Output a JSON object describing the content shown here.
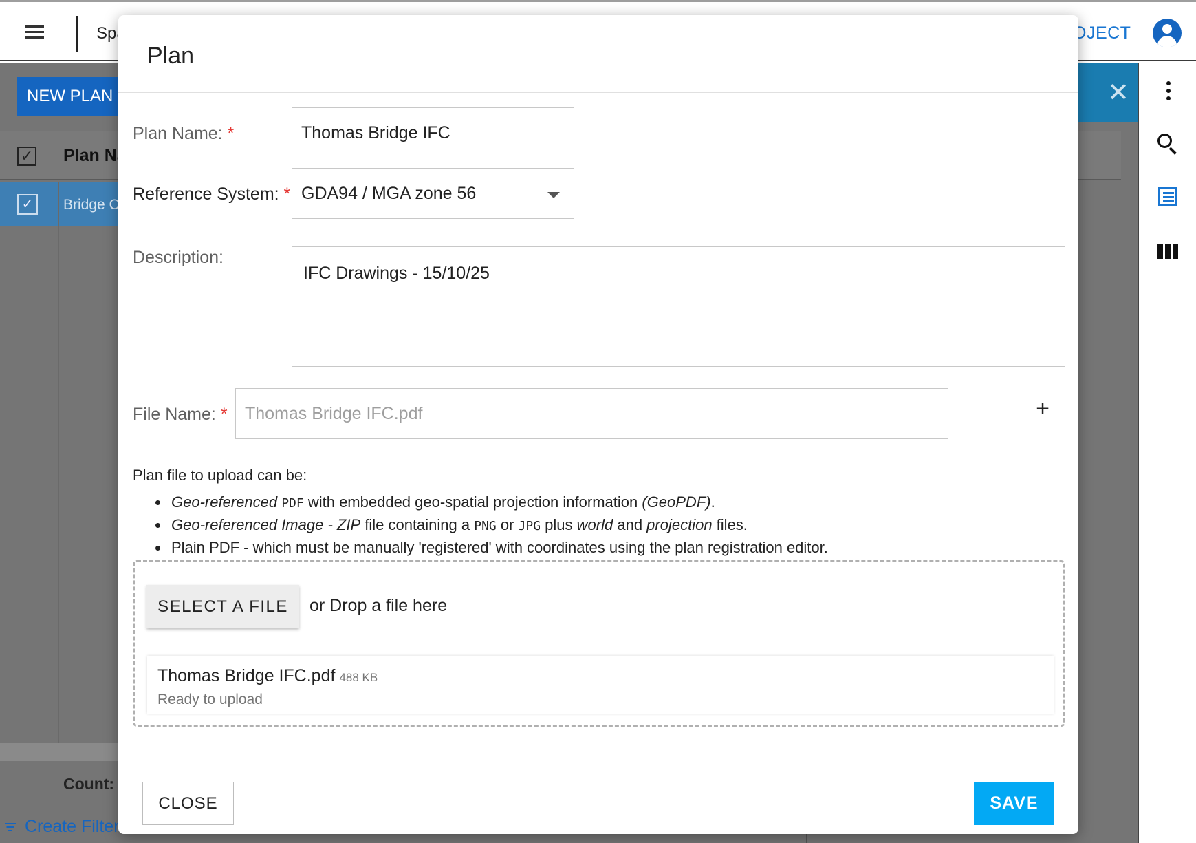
{
  "topbar": {
    "app_title": "Spa",
    "project_link": "OJECT"
  },
  "plans": {
    "new_plan_label": "NEW PLAN",
    "column_header": "Plan Na",
    "selected_row": "Bridge C",
    "count_label": "Count: ",
    "create_filter_label": "Create Filter"
  },
  "icons": {
    "menu": "hamburger-icon",
    "user": "account-circle-icon",
    "panel_close": "close-icon",
    "more": "kebab-icon",
    "search": "search-icon",
    "list": "list-icon",
    "columns": "columns-icon",
    "add": "plus-icon",
    "filter": "filter-icon"
  },
  "colors": {
    "primary": "#1565c0",
    "accent": "#03a9f4",
    "required": "#e53935"
  },
  "dialog": {
    "title": "Plan",
    "plan_name_label": "Plan Name:",
    "plan_name_value": "Thomas Bridge IFC",
    "reference_system_label": "Reference System:",
    "reference_system_value": "GDA94 / MGA zone 56",
    "description_label": "Description:",
    "description_value": "IFC Drawings - 15/10/25",
    "file_name_label": "File Name:",
    "file_name_placeholder": "Thomas Bridge IFC.pdf",
    "required_mark": "*",
    "add_button": "+",
    "info_intro": "Plan file to upload can be:",
    "info_items": {
      "geopdf": {
        "em1": "Geo-referenced ",
        "code": "PDF",
        "text": " with embedded geo-spatial projection information ",
        "em2": "(GeoPDF)",
        "end": "."
      },
      "image": {
        "em1": "Geo-referenced Image - ZIP",
        "text1": " file containing a ",
        "code1": "PNG",
        "text2": " or ",
        "code2": "JPG",
        "text3": " plus ",
        "em2": "world",
        "text4": " and ",
        "em3": "projection",
        "end": " files."
      },
      "plain": "Plain PDF - which must be manually 'registered' with coordinates using the plan registration editor."
    },
    "select_file_label": "SELECT A FILE",
    "drop_hint": "or Drop a file here",
    "file": {
      "name": "Thomas Bridge IFC.pdf",
      "size": "488 KB",
      "status": "Ready to upload"
    },
    "close_label": "CLOSE",
    "save_label": "SAVE"
  }
}
